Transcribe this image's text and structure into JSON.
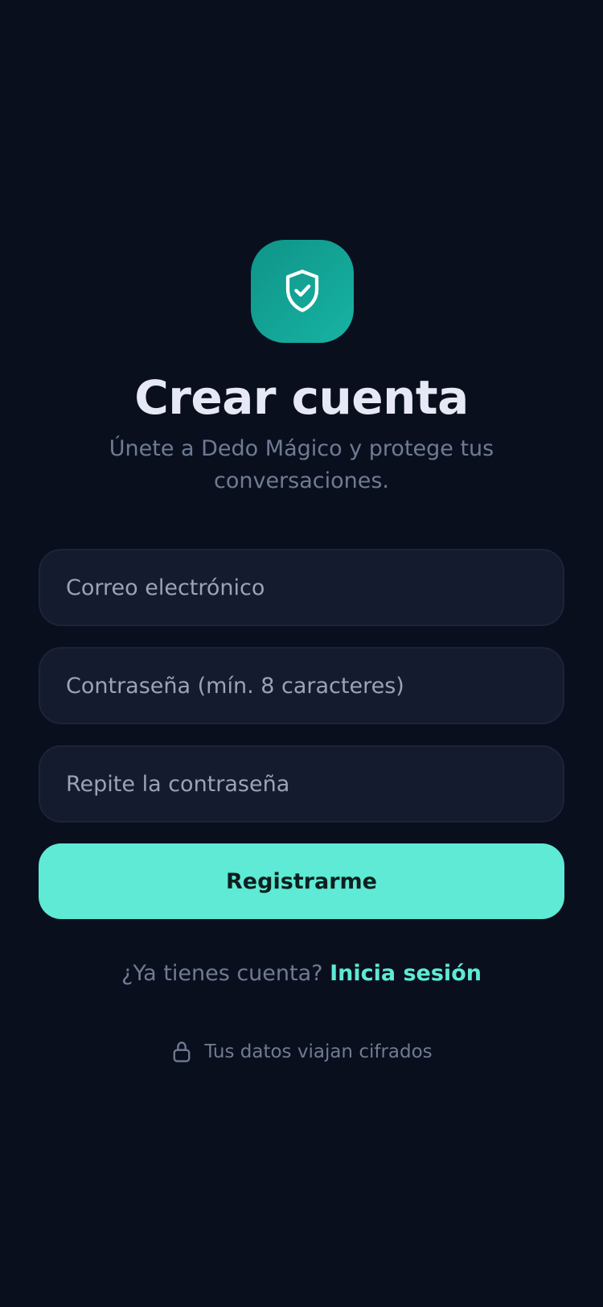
{
  "header": {
    "icon": "shield-check-icon",
    "title": "Crear cuenta",
    "subtitle": "Únete a Dedo Mágico y protege tus conversaciones."
  },
  "form": {
    "email_placeholder": "Correo electrónico",
    "email_value": "",
    "password_placeholder": "Contraseña (mín. 8 caracteres)",
    "password_value": "",
    "repeat_placeholder": "Repite la contraseña",
    "repeat_value": "",
    "submit_label": "Registrarme"
  },
  "login": {
    "prompt": "¿Ya tienes cuenta?",
    "link_label": "Inicia sesión"
  },
  "footer": {
    "icon": "lock-icon",
    "note": "Tus datos viajan cifrados"
  },
  "colors": {
    "background": "#0a0f1e",
    "accent": "#5eead4",
    "icon_tile": "#14a89b",
    "field_bg": "#141b2e",
    "muted_text": "#6f7b93"
  }
}
